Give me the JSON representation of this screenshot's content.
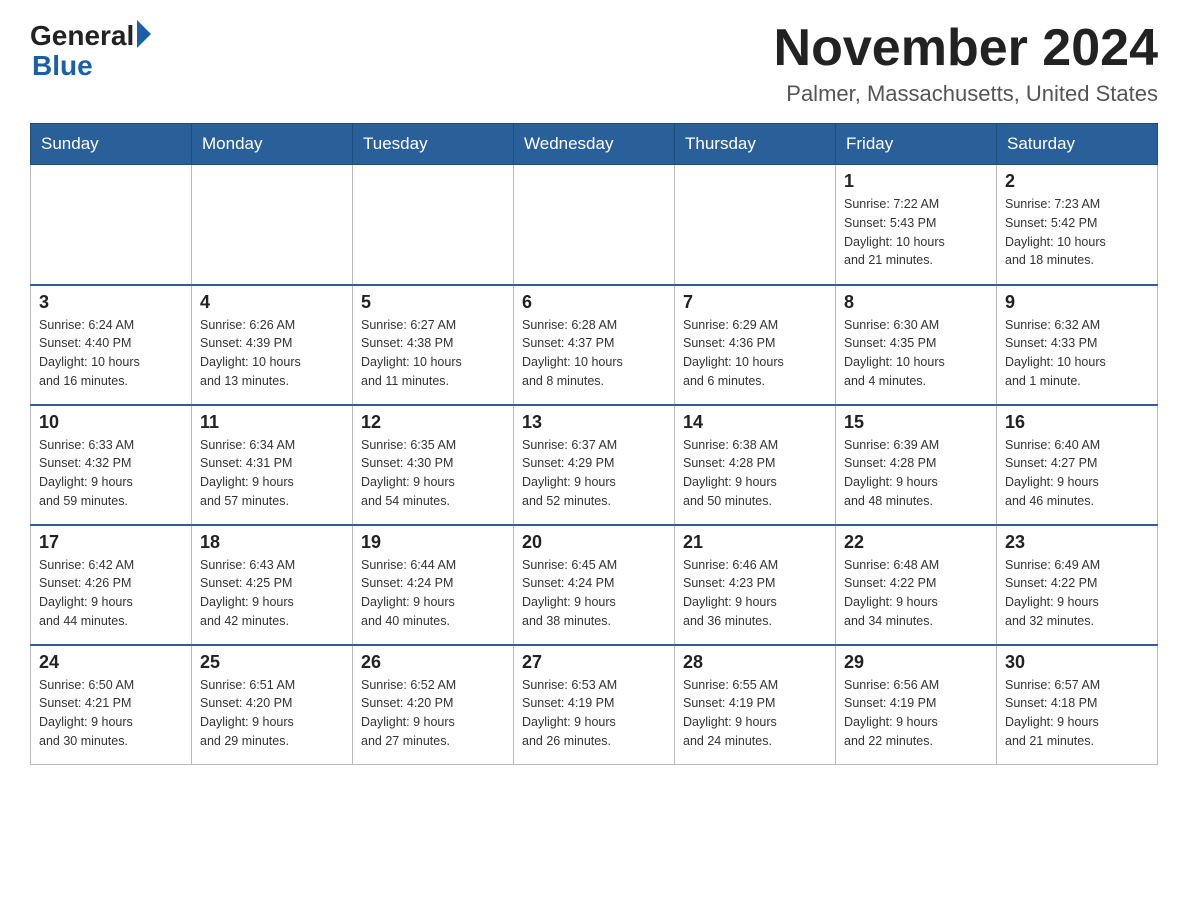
{
  "logo": {
    "general": "General",
    "blue": "Blue"
  },
  "title": "November 2024",
  "subtitle": "Palmer, Massachusetts, United States",
  "days_of_week": [
    "Sunday",
    "Monday",
    "Tuesday",
    "Wednesday",
    "Thursday",
    "Friday",
    "Saturday"
  ],
  "weeks": [
    [
      {
        "day": "",
        "info": ""
      },
      {
        "day": "",
        "info": ""
      },
      {
        "day": "",
        "info": ""
      },
      {
        "day": "",
        "info": ""
      },
      {
        "day": "",
        "info": ""
      },
      {
        "day": "1",
        "info": "Sunrise: 7:22 AM\nSunset: 5:43 PM\nDaylight: 10 hours\nand 21 minutes."
      },
      {
        "day": "2",
        "info": "Sunrise: 7:23 AM\nSunset: 5:42 PM\nDaylight: 10 hours\nand 18 minutes."
      }
    ],
    [
      {
        "day": "3",
        "info": "Sunrise: 6:24 AM\nSunset: 4:40 PM\nDaylight: 10 hours\nand 16 minutes."
      },
      {
        "day": "4",
        "info": "Sunrise: 6:26 AM\nSunset: 4:39 PM\nDaylight: 10 hours\nand 13 minutes."
      },
      {
        "day": "5",
        "info": "Sunrise: 6:27 AM\nSunset: 4:38 PM\nDaylight: 10 hours\nand 11 minutes."
      },
      {
        "day": "6",
        "info": "Sunrise: 6:28 AM\nSunset: 4:37 PM\nDaylight: 10 hours\nand 8 minutes."
      },
      {
        "day": "7",
        "info": "Sunrise: 6:29 AM\nSunset: 4:36 PM\nDaylight: 10 hours\nand 6 minutes."
      },
      {
        "day": "8",
        "info": "Sunrise: 6:30 AM\nSunset: 4:35 PM\nDaylight: 10 hours\nand 4 minutes."
      },
      {
        "day": "9",
        "info": "Sunrise: 6:32 AM\nSunset: 4:33 PM\nDaylight: 10 hours\nand 1 minute."
      }
    ],
    [
      {
        "day": "10",
        "info": "Sunrise: 6:33 AM\nSunset: 4:32 PM\nDaylight: 9 hours\nand 59 minutes."
      },
      {
        "day": "11",
        "info": "Sunrise: 6:34 AM\nSunset: 4:31 PM\nDaylight: 9 hours\nand 57 minutes."
      },
      {
        "day": "12",
        "info": "Sunrise: 6:35 AM\nSunset: 4:30 PM\nDaylight: 9 hours\nand 54 minutes."
      },
      {
        "day": "13",
        "info": "Sunrise: 6:37 AM\nSunset: 4:29 PM\nDaylight: 9 hours\nand 52 minutes."
      },
      {
        "day": "14",
        "info": "Sunrise: 6:38 AM\nSunset: 4:28 PM\nDaylight: 9 hours\nand 50 minutes."
      },
      {
        "day": "15",
        "info": "Sunrise: 6:39 AM\nSunset: 4:28 PM\nDaylight: 9 hours\nand 48 minutes."
      },
      {
        "day": "16",
        "info": "Sunrise: 6:40 AM\nSunset: 4:27 PM\nDaylight: 9 hours\nand 46 minutes."
      }
    ],
    [
      {
        "day": "17",
        "info": "Sunrise: 6:42 AM\nSunset: 4:26 PM\nDaylight: 9 hours\nand 44 minutes."
      },
      {
        "day": "18",
        "info": "Sunrise: 6:43 AM\nSunset: 4:25 PM\nDaylight: 9 hours\nand 42 minutes."
      },
      {
        "day": "19",
        "info": "Sunrise: 6:44 AM\nSunset: 4:24 PM\nDaylight: 9 hours\nand 40 minutes."
      },
      {
        "day": "20",
        "info": "Sunrise: 6:45 AM\nSunset: 4:24 PM\nDaylight: 9 hours\nand 38 minutes."
      },
      {
        "day": "21",
        "info": "Sunrise: 6:46 AM\nSunset: 4:23 PM\nDaylight: 9 hours\nand 36 minutes."
      },
      {
        "day": "22",
        "info": "Sunrise: 6:48 AM\nSunset: 4:22 PM\nDaylight: 9 hours\nand 34 minutes."
      },
      {
        "day": "23",
        "info": "Sunrise: 6:49 AM\nSunset: 4:22 PM\nDaylight: 9 hours\nand 32 minutes."
      }
    ],
    [
      {
        "day": "24",
        "info": "Sunrise: 6:50 AM\nSunset: 4:21 PM\nDaylight: 9 hours\nand 30 minutes."
      },
      {
        "day": "25",
        "info": "Sunrise: 6:51 AM\nSunset: 4:20 PM\nDaylight: 9 hours\nand 29 minutes."
      },
      {
        "day": "26",
        "info": "Sunrise: 6:52 AM\nSunset: 4:20 PM\nDaylight: 9 hours\nand 27 minutes."
      },
      {
        "day": "27",
        "info": "Sunrise: 6:53 AM\nSunset: 4:19 PM\nDaylight: 9 hours\nand 26 minutes."
      },
      {
        "day": "28",
        "info": "Sunrise: 6:55 AM\nSunset: 4:19 PM\nDaylight: 9 hours\nand 24 minutes."
      },
      {
        "day": "29",
        "info": "Sunrise: 6:56 AM\nSunset: 4:19 PM\nDaylight: 9 hours\nand 22 minutes."
      },
      {
        "day": "30",
        "info": "Sunrise: 6:57 AM\nSunset: 4:18 PM\nDaylight: 9 hours\nand 21 minutes."
      }
    ]
  ]
}
